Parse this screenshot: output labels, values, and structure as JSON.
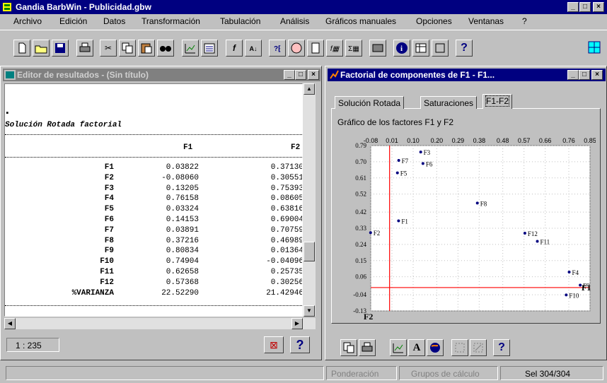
{
  "app": {
    "title": "Gandia BarbWin - Publicidad.gbw"
  },
  "menu": [
    "Archivo",
    "Edición",
    "Datos",
    "Transformación",
    "Tabulación",
    "Análisis",
    "Gráficos manuales",
    "Opciones",
    "Ventanas",
    "?"
  ],
  "toolbar_icons": [
    "new-file-icon",
    "open-folder-icon",
    "save-icon",
    "print-icon",
    "cut-icon",
    "copy-icon",
    "paste-icon",
    "find-icon",
    "chart-edit-icon",
    "printer-preview-icon",
    "formula-icon",
    "sort-icon",
    "help-context-icon",
    "view-icon",
    "calculator-icon",
    "function-icon",
    "sum-icon",
    "film-icon",
    "info-icon",
    "table-icon",
    "tool-icon",
    "help-icon",
    "window-tile-icon"
  ],
  "left_window": {
    "title": "Editor de resultados - (Sin título)",
    "dot": "▪",
    "section_title": "Solución Rotada factorial",
    "col_headers": [
      "F1",
      "F2"
    ],
    "rows": [
      {
        "label": "F1",
        "f1": "0.03822",
        "f2": "0.37130"
      },
      {
        "label": "F2",
        "f1": "-0.08060",
        "f2": "0.30551"
      },
      {
        "label": "F3",
        "f1": "0.13205",
        "f2": "0.75393"
      },
      {
        "label": "F4",
        "f1": "0.76158",
        "f2": "0.08605"
      },
      {
        "label": "F5",
        "f1": "0.03324",
        "f2": "0.63816"
      },
      {
        "label": "F6",
        "f1": "0.14153",
        "f2": "0.69004"
      },
      {
        "label": "F7",
        "f1": "0.03891",
        "f2": "0.70759"
      },
      {
        "label": "F8",
        "f1": "0.37216",
        "f2": "0.46989"
      },
      {
        "label": "F9",
        "f1": "0.80834",
        "f2": "0.01364"
      },
      {
        "label": "F10",
        "f1": "0.74904",
        "f2": "-0.04096"
      },
      {
        "label": "F11",
        "f1": "0.62658",
        "f2": "0.25735"
      },
      {
        "label": "F12",
        "f1": "0.57368",
        "f2": "0.30256"
      },
      {
        "label": "%VARIANZA",
        "f1": "22.52290",
        "f2": "21.42946"
      }
    ],
    "status": "1 : 235",
    "button_x": "⊠",
    "button_help": "?"
  },
  "right_window": {
    "title": "Factorial de componentes de F1 - F1...",
    "tabs": [
      "Solución Rotada",
      "Saturaciones",
      "F1-F2"
    ],
    "active_tab": 2,
    "chart_title": "Gráfico de los factores F1 y F2",
    "bottom_buttons": [
      "copy-icon",
      "print-icon",
      "chart-icon",
      "font-icon",
      "color-icon",
      "labels-icon",
      "label-move-icon",
      "help-icon"
    ],
    "bottom_button_text": {
      "font": "A",
      "help": "?"
    }
  },
  "chart_data": {
    "type": "scatter",
    "title": "Gráfico de los factores F1 y F2",
    "x_ticks": [
      "-0.08",
      "0.01",
      "0.10",
      "0.20",
      "0.29",
      "0.38",
      "0.48",
      "0.57",
      "0.66",
      "0.76",
      "0.85"
    ],
    "y_ticks": [
      "0.79",
      "0.70",
      "0.61",
      "0.52",
      "0.42",
      "0.33",
      "0.24",
      "0.15",
      "0.06",
      "-0.04",
      "-0.13"
    ],
    "xlim": [
      -0.08,
      0.85
    ],
    "ylim": [
      -0.13,
      0.79
    ],
    "axis_label_x": "F1",
    "axis_label_y": "F2",
    "points": [
      {
        "label": "F1",
        "x": 0.03822,
        "y": 0.3713
      },
      {
        "label": "F2",
        "x": -0.0806,
        "y": 0.30551
      },
      {
        "label": "F3",
        "x": 0.13205,
        "y": 0.75393
      },
      {
        "label": "F4",
        "x": 0.76158,
        "y": 0.08605
      },
      {
        "label": "F5",
        "x": 0.03324,
        "y": 0.63816
      },
      {
        "label": "F6",
        "x": 0.14153,
        "y": 0.69004
      },
      {
        "label": "F7",
        "x": 0.03891,
        "y": 0.70759
      },
      {
        "label": "F8",
        "x": 0.37216,
        "y": 0.46989
      },
      {
        "label": "F9",
        "x": 0.80834,
        "y": 0.01364
      },
      {
        "label": "F10",
        "x": 0.74904,
        "y": -0.04096
      },
      {
        "label": "F11",
        "x": 0.62658,
        "y": 0.25735
      },
      {
        "label": "F12",
        "x": 0.57368,
        "y": 0.30256
      }
    ],
    "point_color": "#000080",
    "axis_color": "#ff0000",
    "grid": true
  },
  "statusbar": {
    "ponderacion": "Ponderación",
    "grupos": "Grupos de cálculo",
    "sel": "Sel 304/304"
  }
}
